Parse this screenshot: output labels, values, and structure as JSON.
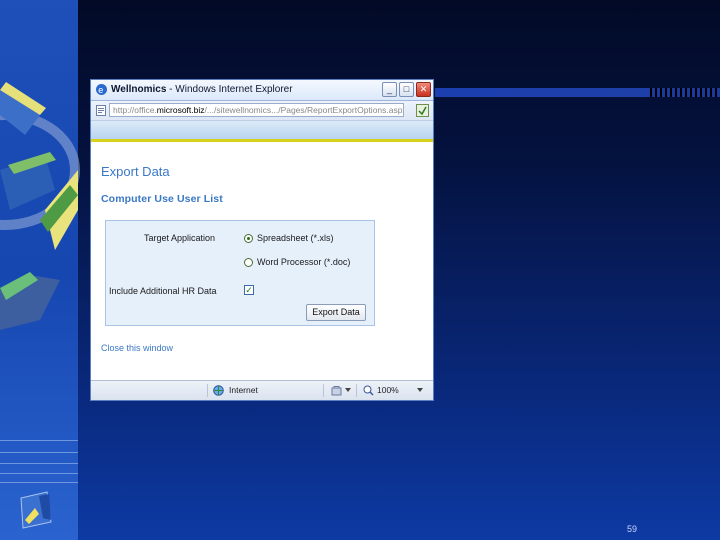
{
  "browser": {
    "title": "Wellnomics - Windows Internet Explorer",
    "title_app": "Wellnomics",
    "title_sep": " - ",
    "title_browser": "Windows Internet Explorer",
    "url_prefix": "http://office.",
    "url_strong": "microsoft.biz",
    "url_rest": "/.../sitewellnomics.../Pages/ReportExportOptions.aspx",
    "buttons": {
      "minimize": "_",
      "maximize": "□",
      "close": "✕"
    }
  },
  "page": {
    "heading": "Export Data",
    "subheading": "Computer Use User List",
    "form": {
      "target_label": "Target Application",
      "option_spreadsheet": "Spreadsheet (*.xls)",
      "option_word": "Word Processor (*.doc)",
      "selected": "Spreadsheet (*.xls)",
      "hr_label": "Include Additional HR Data",
      "hr_checked": true,
      "export_button": "Export Data"
    },
    "close_link": "Close this window"
  },
  "status": {
    "zone": "Internet",
    "zoom": "100%"
  },
  "slide": {
    "page_number": "59"
  },
  "colors": {
    "accent": "#3a78c6",
    "band_yellow": "#d6d11a"
  }
}
